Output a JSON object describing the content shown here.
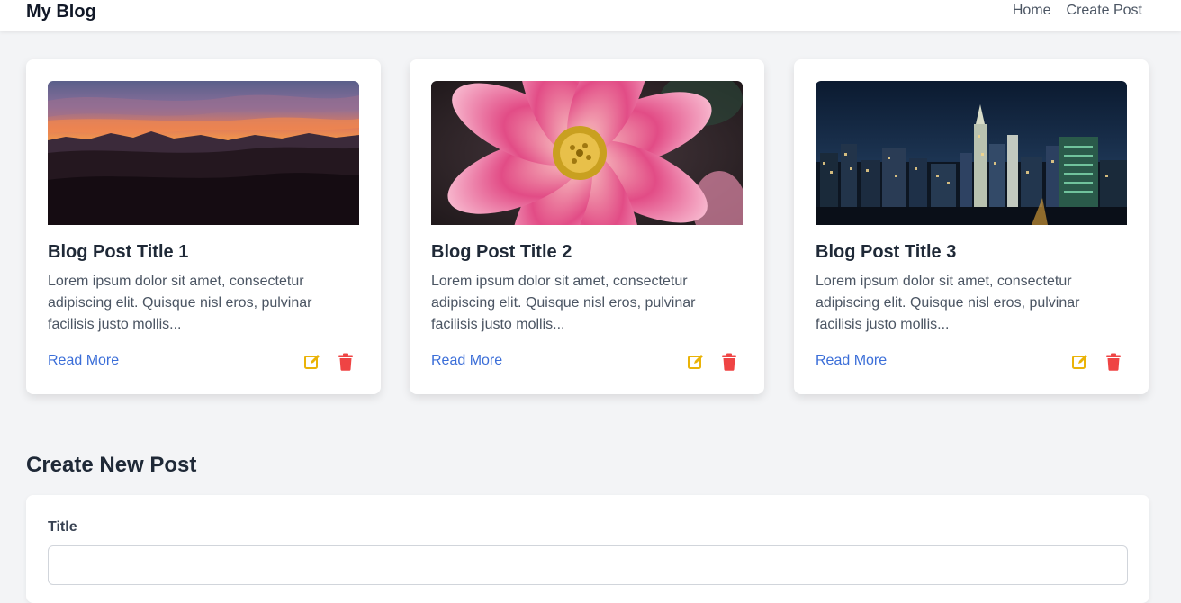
{
  "header": {
    "brand": "My Blog",
    "nav": [
      {
        "label": "Home"
      },
      {
        "label": "Create Post"
      }
    ]
  },
  "posts": [
    {
      "title": "Blog Post Title 1",
      "excerpt": "Lorem ipsum dolor sit amet, consectetur adipiscing elit. Quisque nisl eros, pulvinar facilisis justo mollis...",
      "read_more": "Read More",
      "image": "sunset-mountains"
    },
    {
      "title": "Blog Post Title 2",
      "excerpt": "Lorem ipsum dolor sit amet, consectetur adipiscing elit. Quisque nisl eros, pulvinar facilisis justo mollis...",
      "read_more": "Read More",
      "image": "pink-flower"
    },
    {
      "title": "Blog Post Title 3",
      "excerpt": "Lorem ipsum dolor sit amet, consectetur adipiscing elit. Quisque nisl eros, pulvinar facilisis justo mollis...",
      "read_more": "Read More",
      "image": "city-night-skyline"
    }
  ],
  "icons": {
    "edit": "edit-icon",
    "delete": "trash-icon"
  },
  "colors": {
    "link": "#3b6ed8",
    "edit": "#eab308",
    "delete": "#ef4444",
    "background": "#f3f4f6"
  },
  "create_post": {
    "heading": "Create New Post",
    "title_label": "Title",
    "title_value": ""
  }
}
